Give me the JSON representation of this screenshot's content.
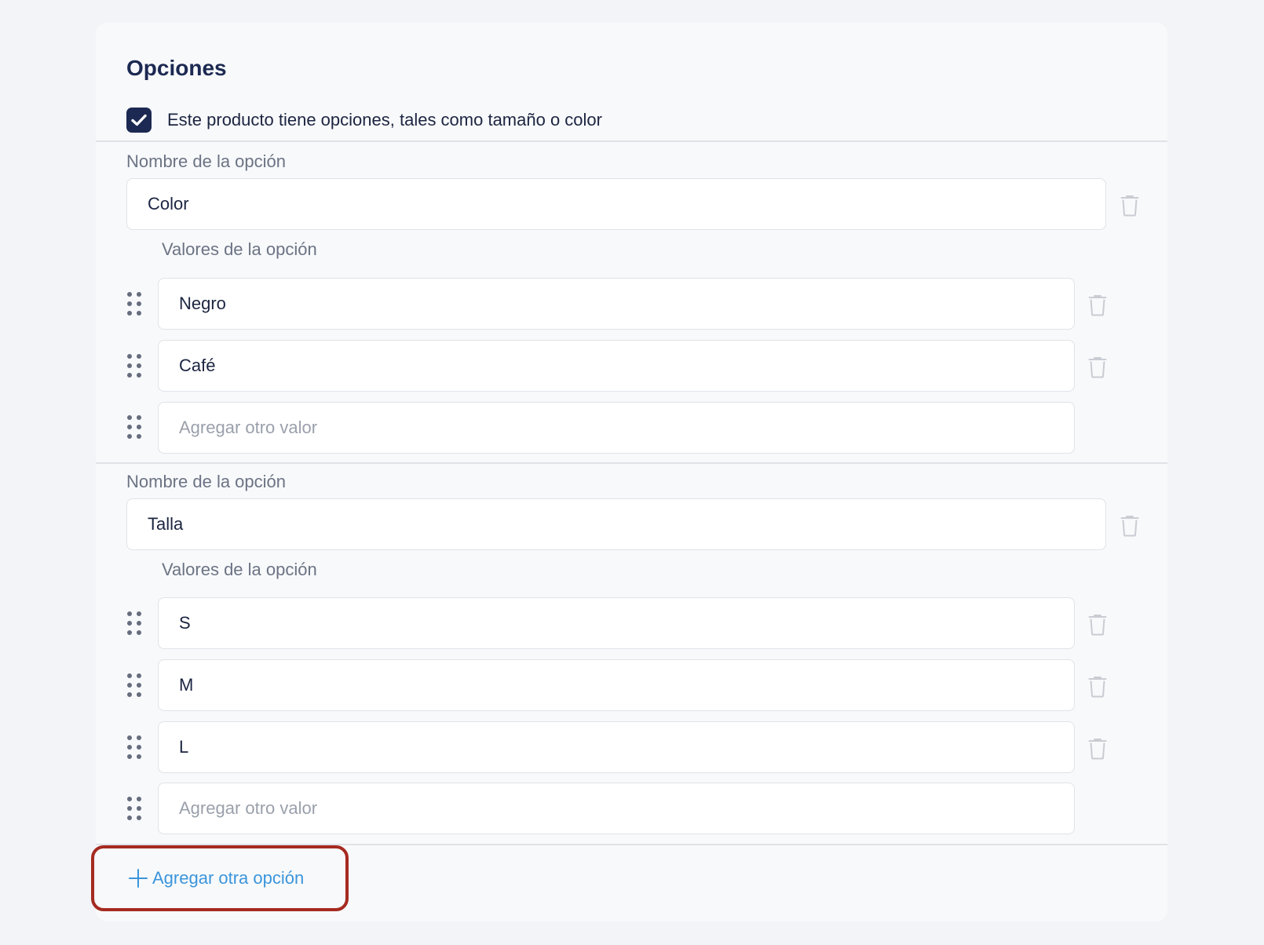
{
  "section": {
    "title": "Opciones",
    "has_options_label": "Este producto tiene opciones, tales como tamaño o color",
    "has_options_checked": true
  },
  "options": [
    {
      "name_label": "Nombre de la opción",
      "name_value": "Color",
      "values_label": "Valores de la opción",
      "values": [
        "Negro",
        "Café"
      ],
      "new_value_placeholder": "Agregar otro valor"
    },
    {
      "name_label": "Nombre de la opción",
      "name_value": "Talla",
      "values_label": "Valores de la opción",
      "values": [
        "S",
        "M",
        "L"
      ],
      "new_value_placeholder": "Agregar otro valor"
    }
  ],
  "add_option": {
    "label": "Agregar otra opción"
  },
  "colors": {
    "brand_dark": "#1c2952",
    "link_blue": "#3b95db",
    "highlight_red": "#a52a20"
  }
}
